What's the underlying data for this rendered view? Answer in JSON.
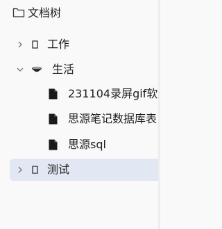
{
  "header": {
    "title": "文档树",
    "icon": "folder-outline-icon"
  },
  "tree": {
    "items": [
      {
        "label": "工作",
        "expanded": false,
        "icon": "empty-box-icon"
      },
      {
        "label": "生活",
        "expanded": true,
        "icon": "bowl-icon",
        "children": [
          {
            "label": "231104录屏gif软",
            "icon": "document-icon"
          },
          {
            "label": "思源笔记数据库表",
            "icon": "document-icon"
          },
          {
            "label": "思源sql",
            "icon": "document-icon"
          }
        ]
      },
      {
        "label": "测试",
        "expanded": false,
        "icon": "empty-box-icon",
        "selected": true
      }
    ]
  },
  "colors": {
    "background": "#f9f9f9",
    "selected_row": "#e1e7f3",
    "text": "#1f1f1f",
    "chevron": "#777777"
  }
}
